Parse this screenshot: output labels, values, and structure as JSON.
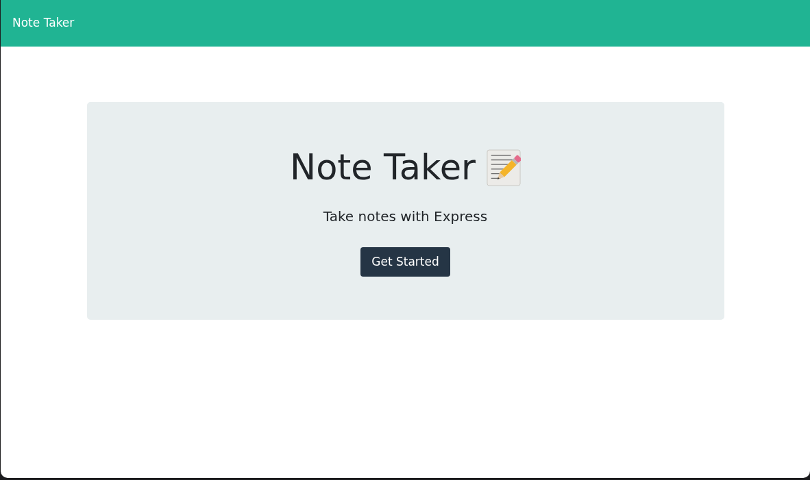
{
  "navbar": {
    "brand": "Note Taker"
  },
  "hero": {
    "title": "Note Taker",
    "subtitle": "Take notes with Express",
    "button": "Get Started"
  }
}
